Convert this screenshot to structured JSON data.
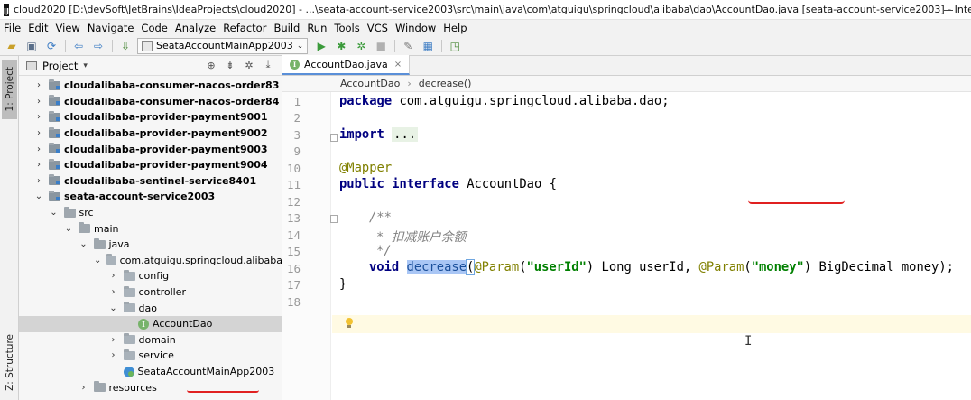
{
  "window": {
    "title": "cloud2020 [D:\\devSoft\\JetBrains\\IdeaProjects\\cloud2020] - ...\\seata-account-service2003\\src\\main\\java\\com\\atguigu\\springcloud\\alibaba\\dao\\AccountDao.java [seata-account-service2003] - IntelliJ IDEA",
    "app_icon": "IJ"
  },
  "menu": [
    "File",
    "Edit",
    "View",
    "Navigate",
    "Code",
    "Analyze",
    "Refactor",
    "Build",
    "Run",
    "Tools",
    "VCS",
    "Window",
    "Help"
  ],
  "toolbar": {
    "run_config": "SeataAccountMainApp2003",
    "icons": [
      "open-folder-icon",
      "save-icon",
      "sync-icon",
      "back-icon",
      "forward-icon",
      "build-icon",
      "run-icon",
      "debug-icon",
      "coverage-icon",
      "stop-icon",
      "project-structure-icon",
      "sdk-icon",
      "deploy-icon"
    ]
  },
  "left_strip": {
    "project_tab": "1: Project",
    "structure_tab": "Z: Structure"
  },
  "project_panel": {
    "title": "Project",
    "tree": [
      {
        "label": "cloudalibaba-consumer-nacos-order83",
        "bold": true,
        "arrow": "›",
        "icon": "module",
        "indent": 0
      },
      {
        "label": "cloudalibaba-consumer-nacos-order84",
        "bold": true,
        "arrow": "›",
        "icon": "module",
        "indent": 0
      },
      {
        "label": "cloudalibaba-provider-payment9001",
        "bold": true,
        "arrow": "›",
        "icon": "module",
        "indent": 0
      },
      {
        "label": "cloudalibaba-provider-payment9002",
        "bold": true,
        "arrow": "›",
        "icon": "module",
        "indent": 0
      },
      {
        "label": "cloudalibaba-provider-payment9003",
        "bold": true,
        "arrow": "›",
        "icon": "module",
        "indent": 0
      },
      {
        "label": "cloudalibaba-provider-payment9004",
        "bold": true,
        "arrow": "›",
        "icon": "module",
        "indent": 0
      },
      {
        "label": "cloudalibaba-sentinel-service8401",
        "bold": true,
        "arrow": "›",
        "icon": "module",
        "indent": 0
      },
      {
        "label": "seata-account-service2003",
        "bold": true,
        "arrow": "⌄",
        "icon": "module",
        "indent": 0
      },
      {
        "label": "src",
        "bold": false,
        "arrow": "⌄",
        "icon": "folder",
        "indent": 1
      },
      {
        "label": "main",
        "bold": false,
        "arrow": "⌄",
        "icon": "folder",
        "indent": 2
      },
      {
        "label": "java",
        "bold": false,
        "arrow": "⌄",
        "icon": "folder",
        "indent": 3
      },
      {
        "label": "com.atguigu.springcloud.alibaba",
        "bold": false,
        "arrow": "⌄",
        "icon": "pkg",
        "indent": 4
      },
      {
        "label": "config",
        "bold": false,
        "arrow": "›",
        "icon": "pkg",
        "indent": 5
      },
      {
        "label": "controller",
        "bold": false,
        "arrow": "›",
        "icon": "pkg",
        "indent": 5
      },
      {
        "label": "dao",
        "bold": false,
        "arrow": "⌄",
        "icon": "pkg",
        "indent": 5
      },
      {
        "label": "AccountDao",
        "bold": false,
        "arrow": "",
        "icon": "interface",
        "indent": 6,
        "selected": true
      },
      {
        "label": "domain",
        "bold": false,
        "arrow": "›",
        "icon": "pkg",
        "indent": 5
      },
      {
        "label": "service",
        "bold": false,
        "arrow": "›",
        "icon": "pkg",
        "indent": 5
      },
      {
        "label": "SeataAccountMainApp2003",
        "bold": false,
        "arrow": "",
        "icon": "spring",
        "indent": 5
      },
      {
        "label": "resources",
        "bold": false,
        "arrow": "›",
        "icon": "folder",
        "indent": 3
      }
    ]
  },
  "editor": {
    "tab_label": "AccountDao.java",
    "tab_icon": "I",
    "breadcrumb": [
      "AccountDao",
      "decrease()"
    ],
    "line_numbers": [
      "1",
      "2",
      "3",
      "9",
      "10",
      "11",
      "12",
      "13",
      "14",
      "15",
      "16",
      "17",
      "18"
    ],
    "code": {
      "l1_kw": "package",
      "l1_rest": " com.atguigu.springcloud.alibaba.dao;",
      "l3_kw": "import",
      "l3_fold": "...",
      "l10_ann": "@Mapper",
      "l11_kw1": "public",
      "l11_kw2": "interface",
      "l11_name": "AccountDao",
      "l11_brace": "{",
      "l13_cmt": "/**",
      "l14_cmt": "* 扣减账户余额",
      "l15_cmt": "*/",
      "l16_kw": "void",
      "l16_method": "decrease",
      "l16_p1": "(",
      "l16_ann1": "@Param",
      "l16_p2": "(",
      "l16_str1": "\"userId\"",
      "l16_p3": ") Long userId, ",
      "l16_ann2": "@Param",
      "l16_p4": "(",
      "l16_str2": "\"money\"",
      "l16_p5": ") BigDecimal money);",
      "l17_brace": "}"
    }
  }
}
